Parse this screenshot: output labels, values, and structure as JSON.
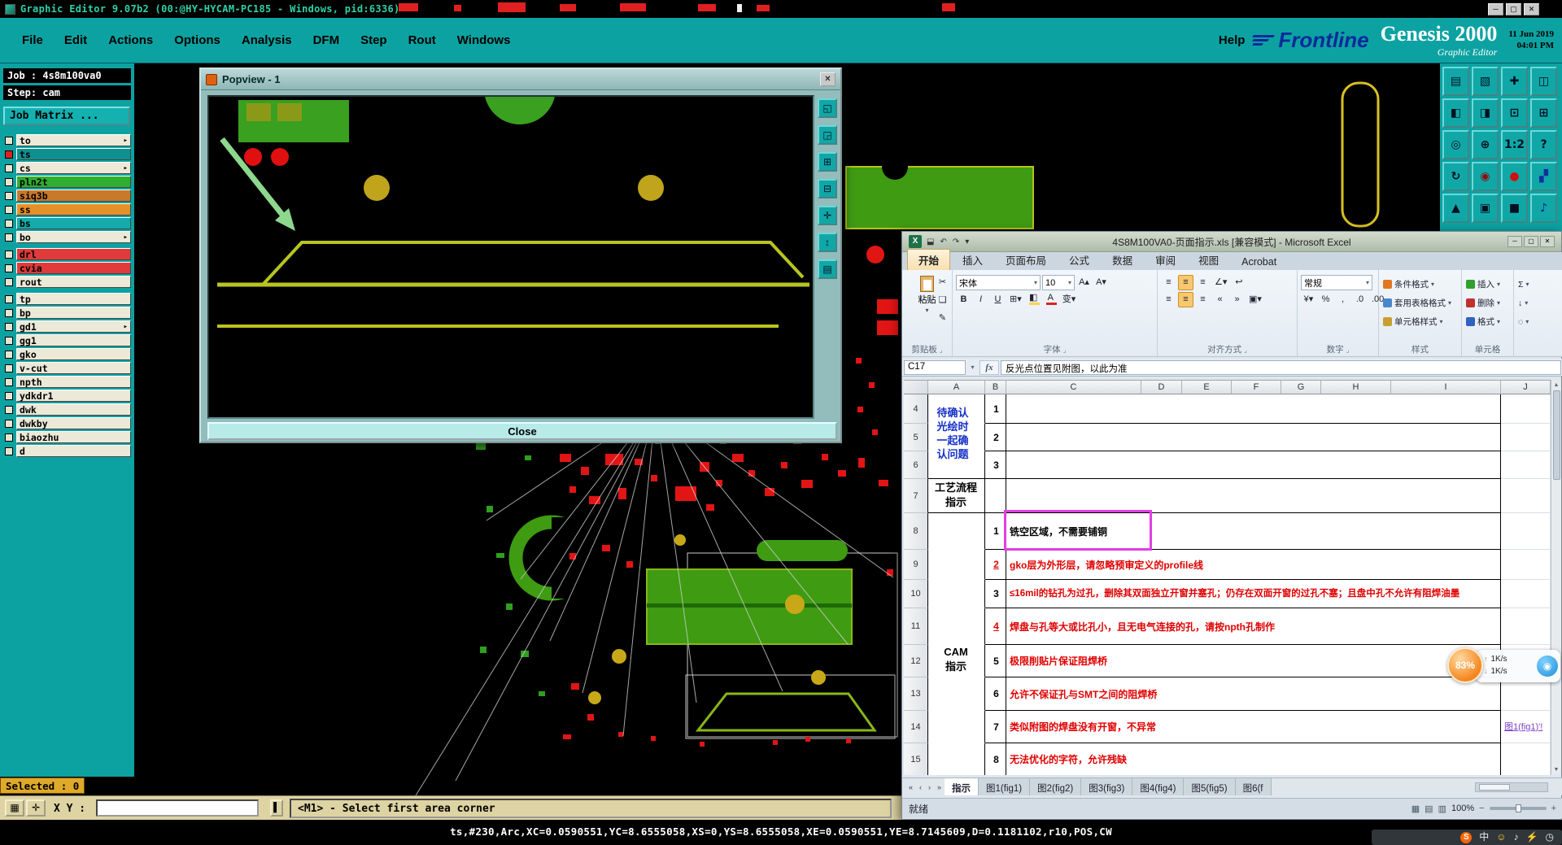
{
  "colors": {
    "teal": "#0da2a2",
    "magenta_highlight": "#e23ee2",
    "red_text": "#e00000",
    "excel_link": "#7a3fc8",
    "arrow_green": "#8ed88e"
  },
  "genesis": {
    "titlebar": {
      "title": "Graphic Editor 9.07b2 (00:@HY-HYCAM-PC185 - Windows, pid:6336)"
    },
    "menus": [
      "File",
      "Edit",
      "Actions",
      "Options",
      "Analysis",
      "DFM",
      "Step",
      "Rout",
      "Windows"
    ],
    "help_menu": "Help",
    "brand": {
      "logo": "Frontline",
      "product": "Genesis 2000",
      "subtitle": "Graphic Editor",
      "date": "11 Jun 2019",
      "time": "04:01 PM"
    },
    "left_panel": {
      "job": "Job : 4s8m100va0",
      "step": "Step: cam",
      "job_matrix": "Job Matrix ...",
      "layers": [
        {
          "name": "to",
          "bg": "#ece9d8",
          "arrow": true
        },
        {
          "name": "ts",
          "bg": "#0e9090",
          "dot": true
        },
        {
          "name": "cs",
          "bg": "#ece9d8",
          "arrow": true
        },
        {
          "name": "pln2t",
          "bg": "#2fae2f"
        },
        {
          "name": "siq3b",
          "bg": "#c9792a"
        },
        {
          "name": "ss",
          "bg": "#e89028"
        },
        {
          "name": "bs",
          "bg": "#16aaaa"
        },
        {
          "name": "bo",
          "bg": "#ece9d8",
          "arrow": true
        },
        {
          "name": "drl",
          "bg": "#e03a3a",
          "gap": true
        },
        {
          "name": "cvia",
          "bg": "#e03a3a"
        },
        {
          "name": "rout",
          "bg": "#ece9d8"
        },
        {
          "name": "tp",
          "bg": "#ece9d8",
          "gap": true
        },
        {
          "name": "bp",
          "bg": "#ece9d8"
        },
        {
          "name": "gd1",
          "bg": "#ece9d8",
          "arrow": true
        },
        {
          "name": "gg1",
          "bg": "#ece9d8"
        },
        {
          "name": "gko",
          "bg": "#ece9d8"
        },
        {
          "name": "v-cut",
          "bg": "#ece9d8"
        },
        {
          "name": "npth",
          "bg": "#ece9d8"
        },
        {
          "name": "ydkdr1",
          "bg": "#ece9d8"
        },
        {
          "name": "dwk",
          "bg": "#ece9d8"
        },
        {
          "name": "dwkby",
          "bg": "#ece9d8"
        },
        {
          "name": "biaozhu",
          "bg": "#ece9d8"
        },
        {
          "name": "d",
          "bg": "#ece9d8"
        }
      ]
    },
    "right_toolbar": [
      {
        "g": "▤"
      },
      {
        "g": "▧"
      },
      {
        "g": "✚"
      },
      {
        "g": "◫"
      },
      {
        "g": "◧"
      },
      {
        "g": "◨"
      },
      {
        "g": "⊡"
      },
      {
        "g": "⊞"
      },
      {
        "g": "◎"
      },
      {
        "g": "⊕"
      },
      {
        "g": "1:2"
      },
      {
        "g": "?"
      },
      {
        "g": "↻"
      },
      {
        "g": "◉",
        "c": "#8a1010"
      },
      {
        "g": "●",
        "c": "#d01010"
      },
      {
        "g": "▞",
        "c": "#1030a0"
      },
      {
        "g": "▲"
      },
      {
        "g": "▣"
      },
      {
        "g": "■"
      },
      {
        "g": "♪",
        "c": "#102080"
      }
    ],
    "popview": {
      "title": "Popview - 1",
      "close": "Close",
      "side_icons": [
        "◱",
        "◲",
        "⊞",
        "⊟",
        "✛",
        "↕",
        "▤"
      ]
    },
    "selected": "Selected : 0",
    "xy_label": "X Y :",
    "prompt": "<M1> - Select first area corner",
    "status_line": "ts,#230,Arc,XC=0.0590551,YC=8.6555058,XS=0,YS=8.6555058,XE=0.0590551,YE=8.7145609,D=0.1181102,r10,POS,CW"
  },
  "excel": {
    "title": "4S8M100VA0-页面指示.xls [兼容模式] - Microsoft Excel",
    "qat_icons": [
      {
        "g": "⬓",
        "n": "save-icon"
      },
      {
        "g": "↶",
        "n": "undo-icon"
      },
      {
        "g": "↷",
        "n": "redo-icon"
      },
      {
        "g": "▾",
        "n": "qat-customize-icon"
      }
    ],
    "ribbon_tabs": [
      {
        "label": "开始",
        "active": true
      },
      {
        "label": "插入"
      },
      {
        "label": "页面布局"
      },
      {
        "label": "公式"
      },
      {
        "label": "数据"
      },
      {
        "label": "审阅"
      },
      {
        "label": "视图"
      },
      {
        "label": "Acrobat"
      }
    ],
    "clipboard": {
      "paste": "粘贴"
    },
    "font": {
      "name": "宋体",
      "size": "10",
      "phonetic": "变"
    },
    "number_format": "常规",
    "group_labels": [
      "剪贴板",
      "字体",
      "对齐方式",
      "数字",
      "样式",
      "单元格"
    ],
    "style_buttons": [
      "条件格式",
      "套用表格格式",
      "单元格样式"
    ],
    "cell_buttons": [
      "插入",
      "删除",
      "格式"
    ],
    "name_box": "C17",
    "fx_label": "fx",
    "formula": "反光点位置见附图，以此为准",
    "columns": [
      "A",
      "B",
      "C",
      "D",
      "E",
      "F",
      "G",
      "H",
      "I",
      "J"
    ],
    "row_numbers": [
      "4",
      "5",
      "6",
      "7",
      "8",
      "9",
      "10",
      "11",
      "12",
      "13",
      "14",
      "15"
    ],
    "cells": {
      "B4": "1",
      "B5": "2",
      "B6": "3",
      "B8": "1",
      "B9": "2",
      "B10": "3",
      "B11": "4",
      "B12": "5",
      "B13": "6",
      "B14": "7",
      "B15": "8",
      "C8": "铣空区域，不需要铺铜",
      "C9": "gko层为外形层，请忽略预审定义的profile线",
      "C10": "≤16mil的钻孔为过孔，删除其双面独立开窗并塞孔；仍存在双面开窗的过孔不塞；且盘中孔不允许有阻焊油墨",
      "C11": "焊盘与孔等大或比孔小，且无电气连接的孔，请按npth孔制作",
      "C12": "极限削贴片保证阻焊桥",
      "C13": "允许不保证孔与SMT之间的阻焊桥",
      "C14": "类似附图的焊盘没有开窗，不异常",
      "C15": "无法优化的字符，允许残缺",
      "J14": "图1(fig1)'!"
    },
    "red_cells": [
      "B9",
      "B11",
      "C9",
      "C10",
      "C11",
      "C12",
      "C13",
      "C14",
      "C15"
    ],
    "underline_cells": [
      "B9",
      "B11"
    ],
    "wrap_cells": [
      "C10"
    ],
    "link_cells": [
      "J14"
    ],
    "merged_labels": {
      "confirm": "待确认光绘时一起确认问题",
      "process": "工艺流程指示",
      "cam": "CAM 指示"
    },
    "sheet_tabs": [
      {
        "label": "指示",
        "active": true
      },
      {
        "label": "图1(fig1)"
      },
      {
        "label": "图2(fig2)"
      },
      {
        "label": "图3(fig3)"
      },
      {
        "label": "图4(fig4)"
      },
      {
        "label": "图5(fig5)"
      },
      {
        "label": "图6(f"
      }
    ],
    "status": {
      "ready": "就绪",
      "zoom": "100%"
    }
  },
  "overlay": {
    "percent": "83%",
    "up": "1K/s",
    "down": "1K/s"
  },
  "tray": {
    "icons": [
      {
        "g": "S",
        "n": "sogou-icon",
        "cls": "sg"
      },
      {
        "g": "中",
        "n": "ime-chinese-icon"
      },
      {
        "g": "☺",
        "n": "smiley-icon",
        "cls": "sm"
      },
      {
        "g": "♪",
        "n": "sound-icon"
      },
      {
        "g": "⚡",
        "n": "usb-icon"
      },
      {
        "g": "◷",
        "n": "clock-icon"
      }
    ]
  }
}
